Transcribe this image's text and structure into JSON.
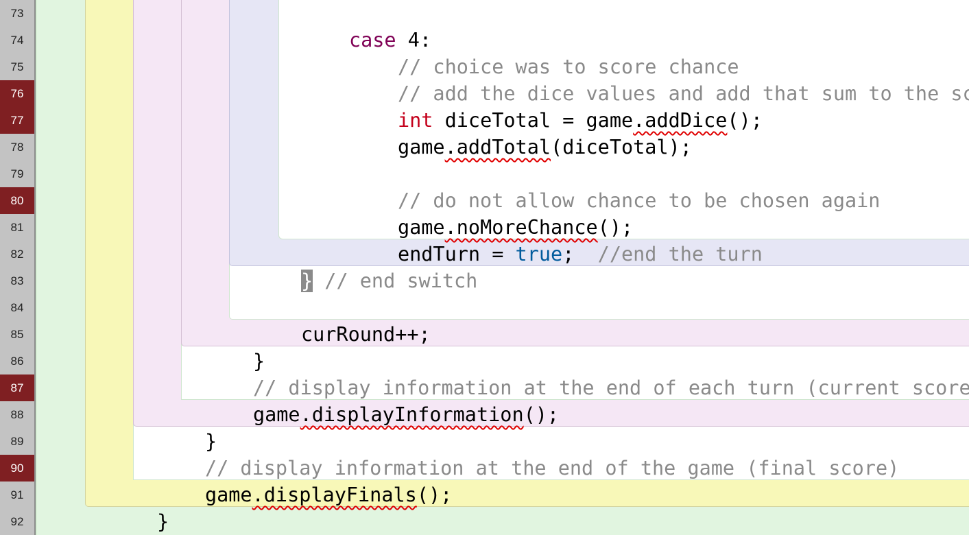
{
  "editor": {
    "line_numbers": [
      "73",
      "74",
      "75",
      "76",
      "77",
      "78",
      "79",
      "80",
      "81",
      "82",
      "83",
      "84",
      "85",
      "86",
      "87",
      "88",
      "89",
      "90",
      "91",
      "92"
    ],
    "breakpoint_lines": [
      "76",
      "77",
      "80",
      "87",
      "90"
    ],
    "colors": {
      "gutter_bg": "#c3c3c3",
      "breakpoint_bg": "#7f1f22",
      "scope_method": "#e1f5e0",
      "scope_loop_outer": "#f8f8b8",
      "scope_loop_inner": "#f5e7f5",
      "scope_switch": "#e6e6f5",
      "scope_case": "#ffffff",
      "keyword": "#7f0055",
      "type_keyword": "#c4001b",
      "literal": "#005a9c",
      "comment": "#8a8a8a",
      "error_underline": "#e00000"
    }
  },
  "code": {
    "l73": {
      "kw": "case",
      "rest": " 4:"
    },
    "l74": {
      "comment": "// choice was to score chance"
    },
    "l75": {
      "comment": "// add the dice values and add that sum to the score"
    },
    "l76": {
      "type": "int",
      "a": " diceTotal = game",
      "err": ".addDice",
      "b": "();"
    },
    "l77": {
      "a": "game",
      "err": ".addTotal",
      "b": "(diceTotal);"
    },
    "l79": {
      "comment": "// do not allow chance to be chosen again"
    },
    "l80": {
      "a": "game",
      "err": ".noMoreChance",
      "b": "();"
    },
    "l81": {
      "a": "endTurn = ",
      "lit": "true",
      "b": ";  ",
      "comment": "//end the turn"
    },
    "l82": {
      "brace": "}",
      "comment": " // end switch"
    },
    "l84": {
      "a": "curRound++;"
    },
    "l85": {
      "a": "}"
    },
    "l86": {
      "comment": "// display information at the end of each turn (current score)"
    },
    "l87": {
      "a": "game",
      "err": ".displayInformation",
      "b": "();"
    },
    "l88": {
      "a": "}"
    },
    "l89": {
      "comment": "// display information at the end of the game (final score)"
    },
    "l90": {
      "a": "game",
      "err": ".displayFinals",
      "b": "();"
    },
    "l91": {
      "a": "}"
    },
    "l92": {
      "a": "}"
    }
  }
}
